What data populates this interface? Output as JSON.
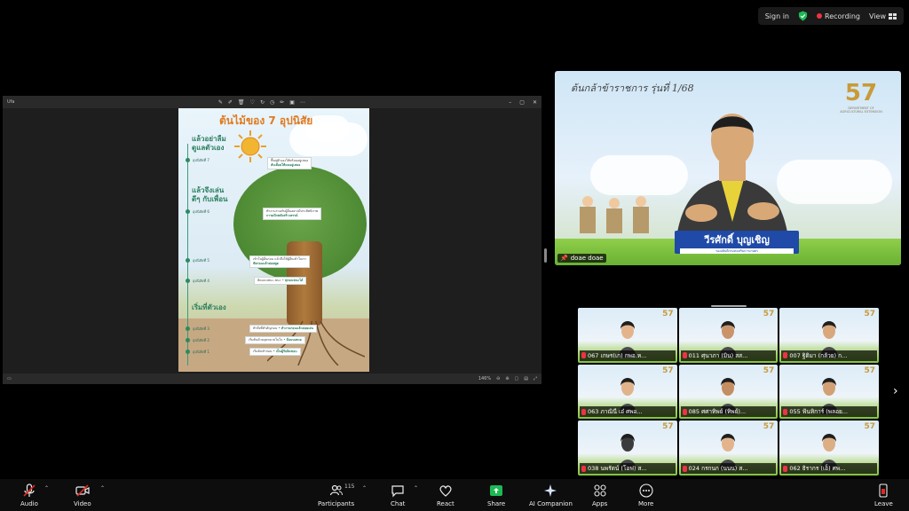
{
  "topbar": {
    "signin": "Sign in",
    "recording": "Recording",
    "view": "View"
  },
  "share": {
    "title": "Ufa",
    "zoom": "146%",
    "poster": {
      "title": "ต้นไม้ของ 7 อุปนิสัย",
      "sections": [
        {
          "heading": "แล้วอย่าลืม ดูแลตัวเอง"
        },
        {
          "heading": "แล้วจึงเล่นดีๆ กับเพื่อน"
        },
        {
          "heading": "เริ่มที่ตัวเอง"
        }
      ],
      "habits": [
        {
          "label": "อุปนิสัยที่ 7",
          "text": "ฟื้นฟูตัวเองให้พร้อมอยู่เสมอ",
          "key": "ลับเลื่อยให้คมอยู่เสมอ"
        },
        {
          "label": "อุปนิสัยที่ 6",
          "text": "ทำงานร่วมกับผู้อื่นอย่างมีประสิทธิภาพ",
          "key": "การผนึกพลังสร้างสรรค์"
        },
        {
          "label": "อุปนิสัยที่ 5",
          "text": "เข้าใจผู้อื่นก่อน แล้วจึงให้ผู้อื่นเข้าใจเรา",
          "key": "ฟังก่อนแล้วค่อยพูด"
        },
        {
          "label": "อุปนิสัยที่ 4",
          "text": "คิดแบบชนะ-ชนะ",
          "key": "ทุกคนชนะได้"
        },
        {
          "label": "อุปนิสัยที่ 3",
          "text": "ทำสิ่งที่สำคัญก่อน",
          "key": "ทำงานก่อนแล้วค่อยเล่น"
        },
        {
          "label": "อุปนิสัยที่ 2",
          "text": "เริ่มต้นด้วยจุดหมายในใจ",
          "key": "มีแผนเสมอ"
        },
        {
          "label": "อุปนิสัยที่ 1",
          "text": "เริ่มต้นทำก่อน",
          "key": "เป็นผู้รับผิดชอบ"
        }
      ]
    }
  },
  "speaker": {
    "banner_title": "ต้นกล้าข้าราชการ รุ่นที่ 1/68",
    "logo_number": "57",
    "logo_sub": "DEPARTMENT OF AGRICULTURAL EXTENSION",
    "name": "วีรศักดิ์ บุญเชิญ",
    "role": "รองอธิบดีกรมส่งเสริมการเกษตร",
    "label": "doae doae"
  },
  "gallery": {
    "tiles": [
      {
        "name": "067 เกษร(เก) กพอ.ห..."
      },
      {
        "name": "011 ศุนาภา (มิน) สส..."
      },
      {
        "name": "007 ฐิติมา (กล้วย) ก..."
      },
      {
        "name": "063 ภาณินี เอ๋ ศพอ..."
      },
      {
        "name": "085 ศศาทิพย์ (ทิพย์)..."
      },
      {
        "name": "055 ฟ้นทิการ์ (พลอย..."
      },
      {
        "name": "038 นพรัตน์ (โอฟ) ส..."
      },
      {
        "name": "024 กรกนก (นนน) ส..."
      },
      {
        "name": "062 ธิรากร (เอ็) ศพ..."
      }
    ],
    "logo": "57"
  },
  "toolbar": {
    "audio": "Audio",
    "video": "Video",
    "participants": "Participants",
    "participants_count": "115",
    "chat": "Chat",
    "react": "React",
    "share": "Share",
    "ai_companion": "AI Companion",
    "apps": "Apps",
    "more": "More",
    "leave": "Leave"
  },
  "colors": {
    "recording": "#e34",
    "share_green": "#1db954",
    "leave_red": "#e02828",
    "nameplate": "#1f4aa8"
  }
}
